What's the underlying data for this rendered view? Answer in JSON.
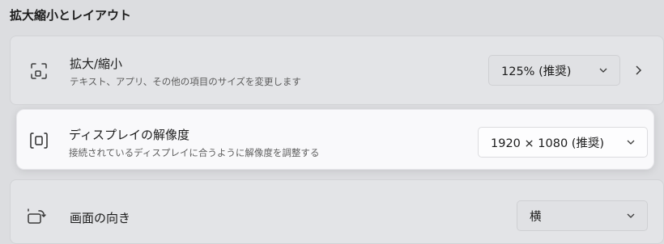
{
  "section": {
    "title": "拡大縮小とレイアウト"
  },
  "zoom": {
    "title": "拡大/縮小",
    "description": "テキスト、アプリ、その他の項目のサイズを変更します",
    "value": "125% (推奨)",
    "icon": "zoom-frame-icon"
  },
  "resolution": {
    "title": "ディスプレイの解像度",
    "description": "接続されているディスプレイに合うように解像度を調整する",
    "value": "1920 × 1080 (推奨)",
    "icon": "resolution-frame-icon"
  },
  "orientation": {
    "title": "画面の向き",
    "value": "横",
    "icon": "screen-rotate-icon"
  }
}
